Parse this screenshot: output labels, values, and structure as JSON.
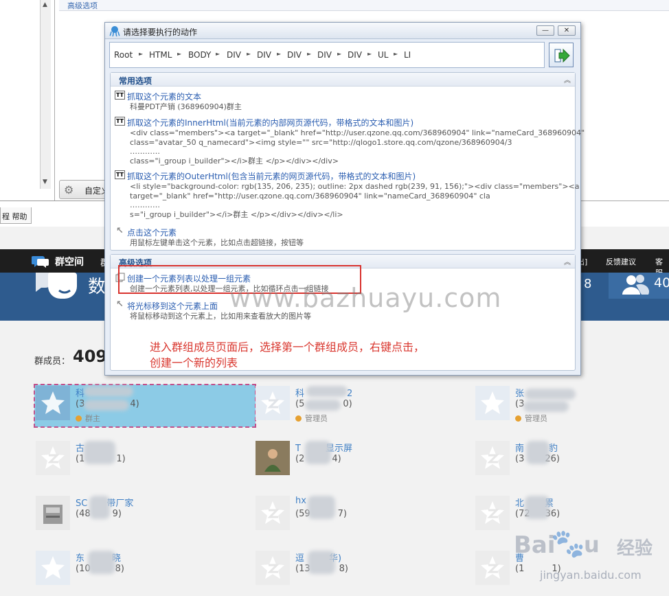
{
  "background_app": {
    "advanced_tab_label": "高级选项",
    "custom_button_label": "自定义",
    "help_tab_label": "程 帮助"
  },
  "qq_page": {
    "nav_title": "群空间",
    "nav_partial": "群",
    "nav_right_partial": "出]",
    "nav_feedback": "反馈建议",
    "nav_help": "客服",
    "banner_title": "数",
    "banner_num": "8",
    "banner_count": "40",
    "members_label": "群成员：",
    "members_count": "409",
    "members": [
      {
        "name": "科",
        "qq": "(3",
        "qq_end": "4)",
        "role": "群主"
      },
      {
        "name": "科",
        "name_end": "2",
        "qq": "(5",
        "qq_end": "0)",
        "role": "管理员"
      },
      {
        "name": "张",
        "qq": "(3",
        "role": "管理员"
      },
      {
        "name": "古",
        "qq": "(1",
        "qq_end": "1)"
      },
      {
        "name": "T",
        "name_end": "显示屏",
        "qq": "(2",
        "qq_end": "4)"
      },
      {
        "name": "南",
        "name_end": "豹",
        "qq": "(3",
        "qq_end": "26)"
      },
      {
        "name": "SC",
        "name_end": "带厂家",
        "qq": "(48",
        "qq_end": "9)"
      },
      {
        "name": "hx",
        "qq": "(59",
        "qq_end": "7)"
      },
      {
        "name": "北",
        "name_end": "累",
        "qq": "(72",
        "qq_end": "36)"
      },
      {
        "name": "东",
        "name_end": "晓",
        "qq": "(10",
        "qq_end": "8)"
      },
      {
        "name": "逗",
        "name_end": "华)",
        "qq": "(13",
        "qq_end": "8)"
      },
      {
        "name": "曹",
        "qq": "(1",
        "qq_end": "1)"
      }
    ]
  },
  "dialog": {
    "title": "请选择要执行的动作",
    "minimize_label": "—",
    "close_label": "✕",
    "path": [
      "Root",
      "HTML",
      "BODY",
      "DIV",
      "DIV",
      "DIV",
      "DIV",
      "DIV",
      "UL",
      "LI"
    ],
    "common_section_title": "常用选项",
    "advanced_section_title": "高级选项",
    "options": {
      "text": {
        "title": "抓取这个元素的文本",
        "desc": "科曼PDT产销 (368960904)群主"
      },
      "inner": {
        "title": "抓取这个元素的InnerHtml(当前元素的内部网页源代码，带格式的文本和图片)",
        "lines": [
          "<div class=\"members\"><a target=\"_blank\" href=\"http://user.qzone.qq.com/368960904\" link=\"nameCard_368960904\"",
          "class=\"avatar_50 q_namecard\"><img style=\"\" src=\"http://qlogo1.store.qq.com/qzone/368960904/3",
          "…………",
          " class=\"i_group i_builder\"></i>群主 </p></div></div>"
        ]
      },
      "outer": {
        "title": "抓取这个元素的OuterHtml(包含当前元素的网页源代码，带格式的文本和图片)",
        "lines": [
          "<li style=\"background-color: rgb(135, 206, 235); outline: 2px dashed rgb(239, 91, 156);\"><div class=\"members\"><a",
          "target=\"_blank\" href=\"http://user.qzone.qq.com/368960904\" link=\"nameCard_368960904\" cla",
          "…………",
          "s=\"i_group i_builder\"></i>群主 </p></div></div></li>"
        ]
      },
      "click": {
        "title": "点击这个元素",
        "desc": "用鼠标左键单击这个元素，比如点击超链接，按钮等"
      },
      "list": {
        "title": "创建一个元素列表以处理一组元素",
        "desc": "创建一个元素列表,以处理一组元素，比如循环点击一组链接"
      },
      "hover": {
        "title": "将光标移到这个元素上面",
        "desc": "将鼠标移动到这个元素上，比如用来查看放大的图片等"
      }
    }
  },
  "annotation": {
    "line1": "进入群组成员页面后，选择第一个群组成员，右键点击，",
    "line2": "创建一个新的列表"
  },
  "watermarks": {
    "center": "www.bazhuayu.com",
    "baidu_b1": "Bai",
    "baidu_paw": "🐾",
    "baidu_b2": "u",
    "baidu_b3": "经验",
    "baidu_url": "jingyan.baidu.com"
  },
  "colors": {
    "link": "#2a5db0",
    "highlight": "#d8332e",
    "selected_member": "#8ccbe6",
    "banner": "#2e5b8e"
  }
}
